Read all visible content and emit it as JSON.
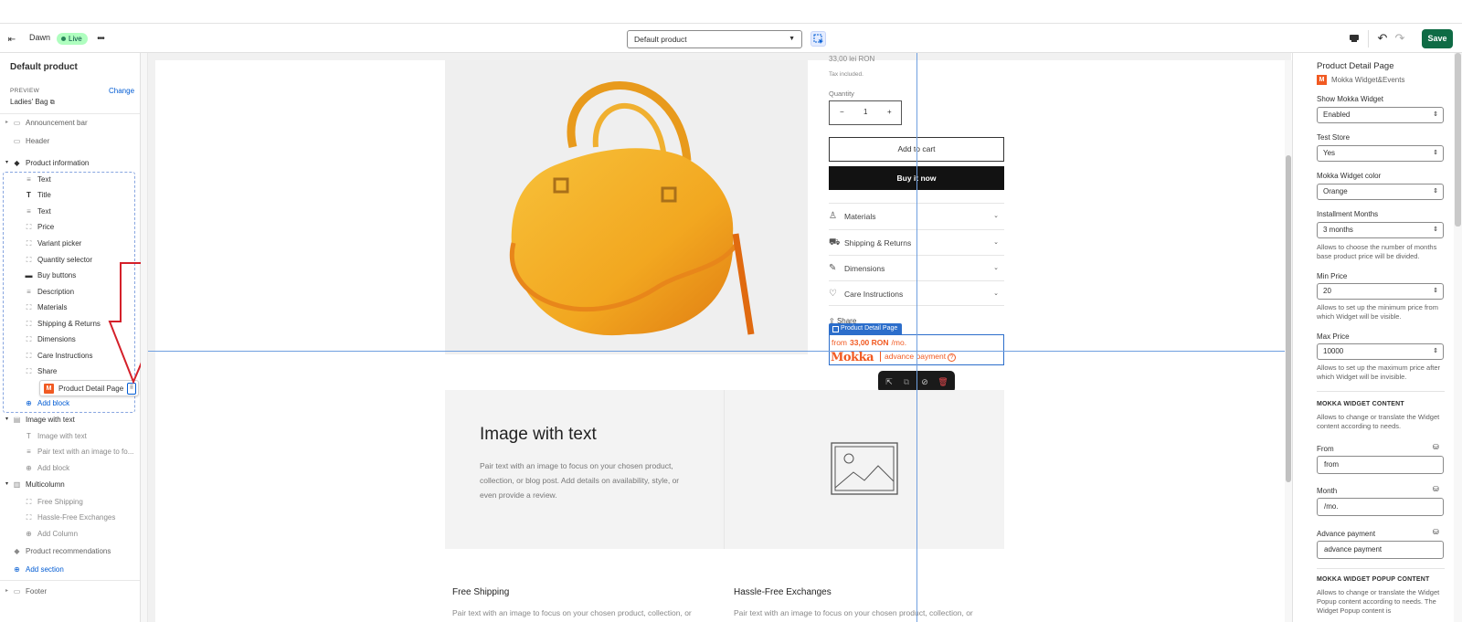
{
  "topbar": {
    "theme": "Dawn",
    "status": "Live",
    "template": "Default product",
    "save": "Save"
  },
  "left": {
    "title": "Default product",
    "preview_label": "PREVIEW",
    "change": "Change",
    "preview_value": "Ladies' Bag",
    "items": [
      {
        "label": "Announcement bar"
      },
      {
        "label": "Header"
      },
      {
        "label": "Product information"
      },
      {
        "label": "Text"
      },
      {
        "label": "Title"
      },
      {
        "label": "Text"
      },
      {
        "label": "Price"
      },
      {
        "label": "Variant picker"
      },
      {
        "label": "Quantity selector"
      },
      {
        "label": "Buy buttons"
      },
      {
        "label": "Description"
      },
      {
        "label": "Materials"
      },
      {
        "label": "Shipping & Returns"
      },
      {
        "label": "Dimensions"
      },
      {
        "label": "Care Instructions"
      },
      {
        "label": "Share"
      },
      {
        "label": "Add block"
      },
      {
        "label": "Image with text"
      },
      {
        "label": "Image with text"
      },
      {
        "label": "Pair text with an image to fo..."
      },
      {
        "label": "Add block"
      },
      {
        "label": "Multicolumn"
      },
      {
        "label": "Free Shipping"
      },
      {
        "label": "Hassle-Free Exchanges"
      },
      {
        "label": "Add Column"
      },
      {
        "label": "Product recommendations"
      },
      {
        "label": "Add section"
      },
      {
        "label": "Footer"
      }
    ],
    "drag_label": "Product Detail Page"
  },
  "preview": {
    "price": "33,00 lei RON",
    "tax": "Tax included.",
    "quantity_label": "Quantity",
    "qty": "1",
    "add_to_cart": "Add to cart",
    "buy_now": "Buy it now",
    "accordions": [
      {
        "label": "Materials"
      },
      {
        "label": "Shipping & Returns"
      },
      {
        "label": "Dimensions"
      },
      {
        "label": "Care Instructions"
      }
    ],
    "share": "Share",
    "block_tag": "Product Detail Page",
    "mokka_from": "from",
    "mokka_amount": "33,00 RON",
    "mokka_month": "/mo.",
    "mokka_logo": "Mokka",
    "mokka_advance": "advance payment",
    "mokka_q": "?",
    "iwt_title": "Image with text",
    "iwt_text": "Pair text with an image to focus on your chosen product, collection, or blog post. Add details on availability, style, or even provide a review.",
    "col1_title": "Free Shipping",
    "col1_text": "Pair text with an image to focus on your chosen product, collection, or",
    "col2_title": "Hassle-Free Exchanges",
    "col2_text": "Pair text with an image to focus on your chosen product, collection, or"
  },
  "right": {
    "title": "Product Detail Page",
    "app": "Mokka Widget&Events",
    "show_label": "Show Mokka Widget",
    "show_val": "Enabled",
    "test_label": "Test Store",
    "test_val": "Yes",
    "color_label": "Mokka Widget color",
    "color_val": "Orange",
    "months_label": "Installment Months",
    "months_val": "3 months",
    "months_help": "Allows to choose the number of months base product price will be divided.",
    "min_label": "Min Price",
    "min_val": "20",
    "min_help": "Allows to set up the minimum price from which Widget will be visible.",
    "max_label": "Max Price",
    "max_val": "10000",
    "max_help": "Allows to set up the maximum price after which Widget will be invisible.",
    "content_head": "MOKKA WIDGET CONTENT",
    "content_help": "Allows to change or translate the Widget content according to needs.",
    "from_label": "From",
    "from_val": "from",
    "month_label": "Month",
    "month_val": "/mo.",
    "adv_label": "Advance payment",
    "adv_val": "advance payment",
    "popup_head": "MOKKA WIDGET POPUP CONTENT",
    "popup_help": "Allows to change or translate the Widget Popup content according to needs. The Widget Popup content is"
  },
  "colors": {
    "accent": "#005bd3",
    "save": "#0f6b45",
    "mokka": "#f15a22",
    "selection": "#2c6ecb"
  }
}
